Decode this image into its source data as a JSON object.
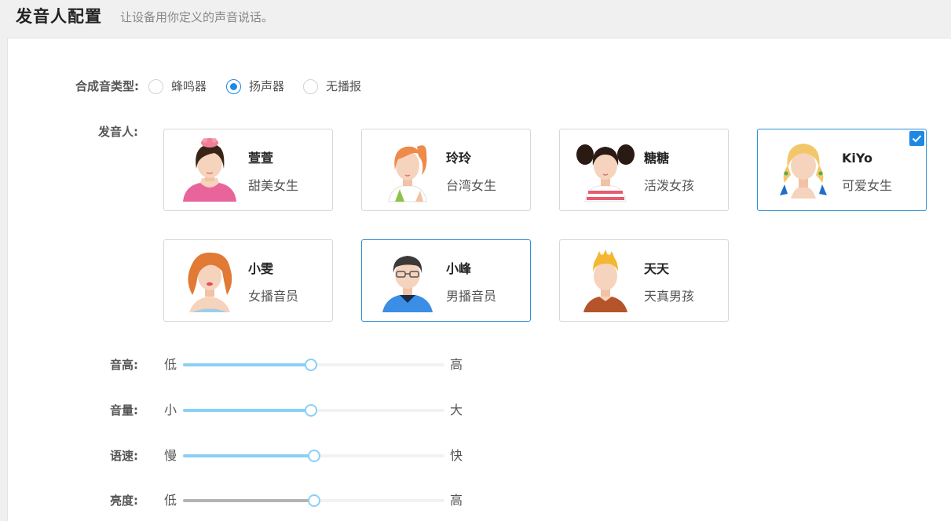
{
  "header": {
    "title": "发音人配置",
    "subtitle": "让设备用你定义的声音说话。"
  },
  "synthesis": {
    "label": "合成音类型:",
    "options": [
      {
        "label": "蜂鸣器",
        "checked": false
      },
      {
        "label": "扬声器",
        "checked": true
      },
      {
        "label": "无播报",
        "checked": false
      }
    ]
  },
  "speakers": {
    "label": "发音人:",
    "items": [
      {
        "name": "萱萱",
        "desc": "甜美女生",
        "selected": false
      },
      {
        "name": "玲玲",
        "desc": "台湾女生",
        "selected": false
      },
      {
        "name": "糖糖",
        "desc": "活泼女孩",
        "selected": false
      },
      {
        "name": "KiYo",
        "desc": "可爱女生",
        "selected": true
      },
      {
        "name": "小雯",
        "desc": "女播音员",
        "selected": false
      },
      {
        "name": "小峰",
        "desc": "男播音员",
        "selected": false
      },
      {
        "name": "天天",
        "desc": "天真男孩",
        "selected": false
      }
    ]
  },
  "sliders": [
    {
      "label": "音高:",
      "min": "低",
      "max": "高",
      "value": 0.49
    },
    {
      "label": "音量:",
      "min": "小",
      "max": "大",
      "value": 0.49
    },
    {
      "label": "语速:",
      "min": "慢",
      "max": "快",
      "value": 0.5
    },
    {
      "label": "亮度:",
      "min": "低",
      "max": "高",
      "value": 0.5
    }
  ],
  "colors": {
    "accent": "#1e88e5",
    "slider_fill": "#8ad0f4",
    "slider_fill_disabled": "#b4b4b4"
  }
}
